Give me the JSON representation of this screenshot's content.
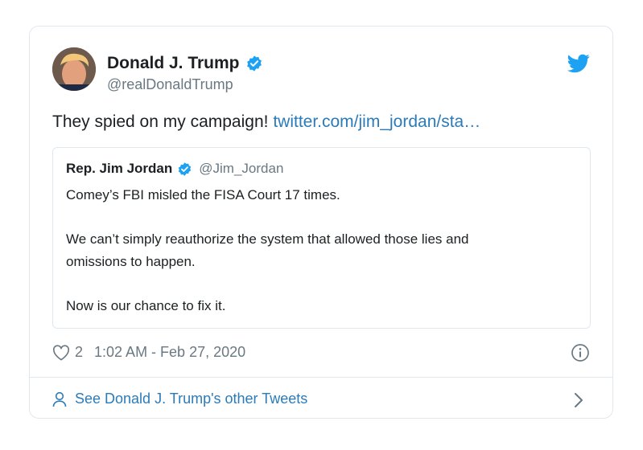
{
  "tweet": {
    "display_name": "Donald J. Trump",
    "handle": "@realDonaldTrump",
    "text": "They spied on my campaign!",
    "link_text": "twitter.com/jim_jordan/sta…",
    "like_count": "2",
    "timestamp": "1:02 AM - Feb 27, 2020",
    "verified_icon": "verified-badge-icon",
    "brand_icon": "twitter-bird-icon"
  },
  "quoted_tweet": {
    "display_name": "Rep. Jim Jordan",
    "handle": "@Jim_Jordan",
    "lines": [
      "Comey’s FBI misled the FISA Court 17 times.",
      "We can’t simply reauthorize the system that allowed those lies and",
      "omissions to happen.",
      "Now is our chance to fix it."
    ]
  },
  "footer": {
    "label": "See Donald J. Trump's other Tweets",
    "icon": "person-icon"
  },
  "colors": {
    "accent": "#1da1f2",
    "link": "#2b7bb9",
    "secondary_text": "#697882",
    "border": "#e1e8ed"
  }
}
